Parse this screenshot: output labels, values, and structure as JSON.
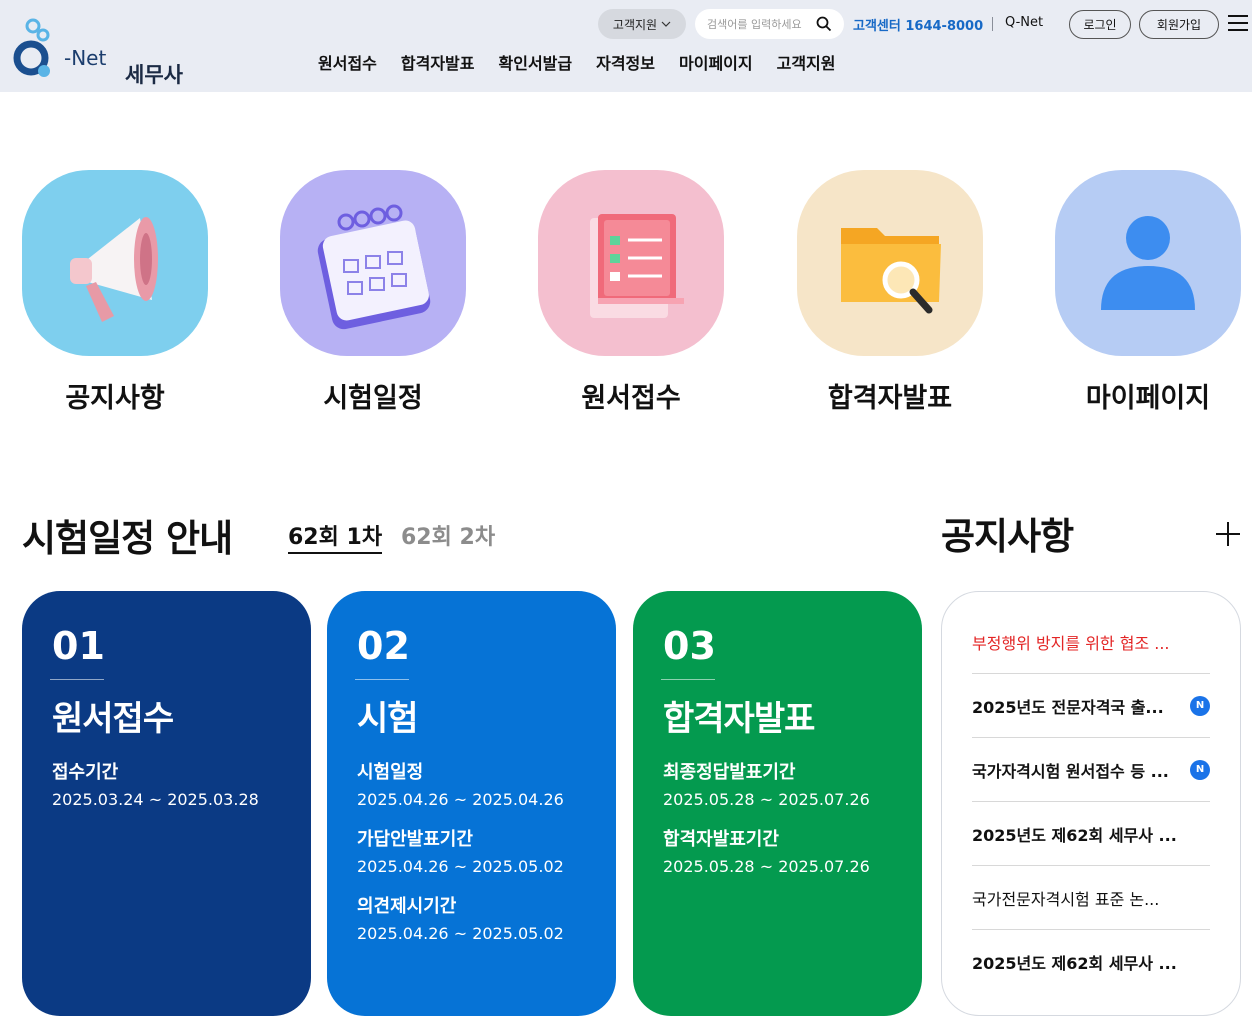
{
  "logo": {
    "brand": "-Net",
    "site": "세무사"
  },
  "util": {
    "support_dropdown": "고객지원",
    "search_placeholder": "검색어를 입력하세요",
    "cs_center": "고객센터 1644-8000",
    "qnet_link": "Q-Net",
    "login": "로그인",
    "join": "회원가입"
  },
  "gnb": [
    "원서접수",
    "합격자발표",
    "확인서발급",
    "자격정보",
    "마이페이지",
    "고객지원"
  ],
  "quick_menu": [
    {
      "label": "공지사항",
      "icon": "megaphone-icon",
      "bg": "#7ecfee"
    },
    {
      "label": "시험일정",
      "icon": "calendar-icon",
      "bg": "#b7b1f4"
    },
    {
      "label": "원서접수",
      "icon": "document-icon",
      "bg": "#f4bfcf"
    },
    {
      "label": "합격자발표",
      "icon": "folder-search-icon",
      "bg": "#f6e5c8"
    },
    {
      "label": "마이페이지",
      "icon": "user-icon",
      "bg": "#b6ccf4"
    }
  ],
  "schedule": {
    "title": "시험일정 안내",
    "tabs": [
      "62회 1차",
      "62회 2차"
    ],
    "cards": [
      {
        "num": "01",
        "title": "원서접수",
        "color": "#0b3a84",
        "items": [
          {
            "k": "접수기간",
            "v": "2025.03.24 ~ 2025.03.28"
          }
        ]
      },
      {
        "num": "02",
        "title": "시험",
        "color": "#0673d6",
        "items": [
          {
            "k": "시험일정",
            "v": "2025.04.26 ~ 2025.04.26"
          },
          {
            "k": "가답안발표기간",
            "v": "2025.04.26 ~ 2025.05.02"
          },
          {
            "k": "의견제시기간",
            "v": "2025.04.26 ~ 2025.05.02"
          }
        ]
      },
      {
        "num": "03",
        "title": "합격자발표",
        "color": "#049a4f",
        "items": [
          {
            "k": "최종정답발표기간",
            "v": "2025.05.28 ~ 2025.07.26"
          },
          {
            "k": "합격자발표기간",
            "v": "2025.05.28 ~ 2025.07.26"
          }
        ]
      }
    ]
  },
  "notice": {
    "title": "공지사항",
    "items": [
      {
        "text": "부정행위 방지를 위한 협조 ...",
        "style": "alert",
        "new": false
      },
      {
        "text": "2025년도 전문자격국 출...",
        "style": "bold",
        "new": true
      },
      {
        "text": "국가자격시험 원서접수 등 ...",
        "style": "bold",
        "new": true
      },
      {
        "text": "2025년도 제62회 세무사 ...",
        "style": "bold",
        "new": false
      },
      {
        "text": "국가전문자격시험 표준 논...",
        "style": "plain",
        "new": false
      },
      {
        "text": "2025년도 제62회 세무사 ...",
        "style": "bold",
        "new": false
      }
    ],
    "new_badge": "N"
  }
}
